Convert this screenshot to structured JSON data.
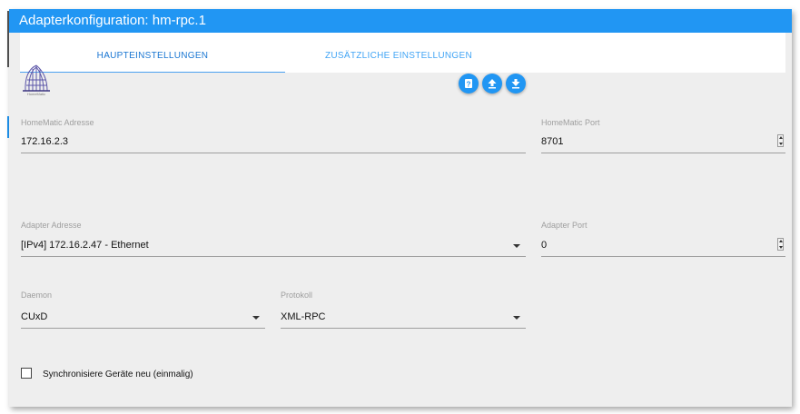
{
  "window": {
    "title": "Adapterkonfiguration: hm-rpc.1"
  },
  "tabs": [
    {
      "label": "HAUPTEINSTELLUNGEN",
      "active": true
    },
    {
      "label": "ZUSÄTZLICHE EINSTELLUNGEN",
      "active": false
    }
  ],
  "logo": {
    "icon": "homematic-logo-icon",
    "caption": "HomeMatic"
  },
  "toolbar": {
    "buttons": [
      {
        "icon": "help-icon"
      },
      {
        "icon": "upload-icon"
      },
      {
        "icon": "download-icon"
      }
    ]
  },
  "fields": {
    "homematic_address": {
      "label": "HomeMatic Adresse",
      "value": "172.16.2.3"
    },
    "homematic_port": {
      "label": "HomeMatic Port",
      "value": "8701"
    },
    "adapter_address": {
      "label": "Adapter Adresse",
      "value": "[IPv4] 172.16.2.47 - Ethernet"
    },
    "adapter_port": {
      "label": "Adapter Port",
      "value": "0"
    },
    "daemon": {
      "label": "Daemon",
      "value": "CUxD"
    },
    "protocol": {
      "label": "Protokoll",
      "value": "XML-RPC"
    }
  },
  "sync": {
    "label": "Synchronisiere Geräte neu (einmalig)",
    "checked": false
  },
  "colors": {
    "accent": "#2196f3",
    "background": "#eeeeee"
  }
}
